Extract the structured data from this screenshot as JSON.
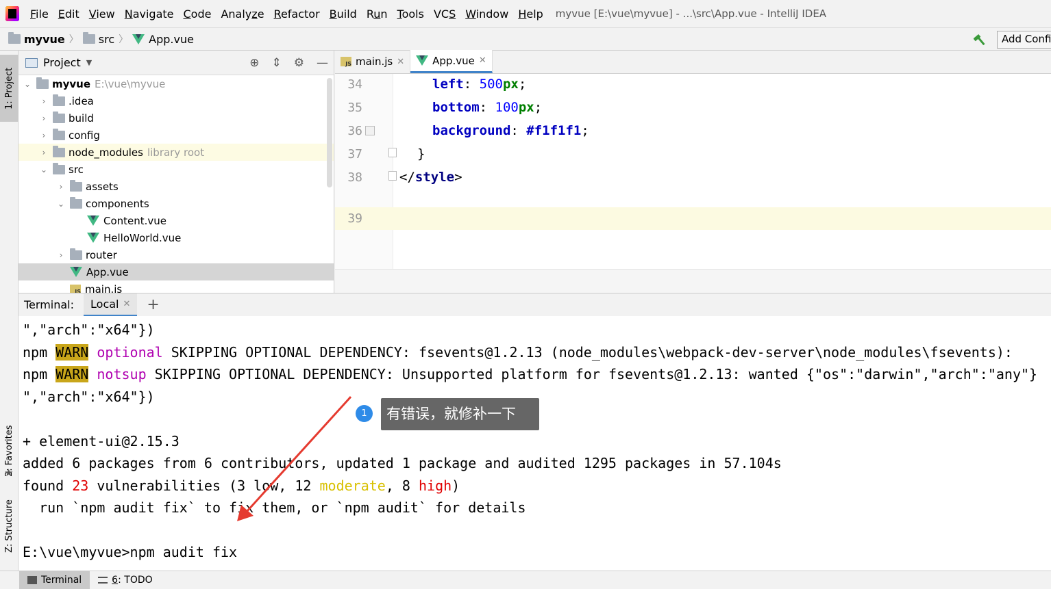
{
  "window_title": "myvue [E:\\vue\\myvue] - ...\\src\\App.vue - IntelliJ IDEA",
  "menu": [
    {
      "pre": "",
      "u": "F",
      "post": "ile"
    },
    {
      "pre": "",
      "u": "E",
      "post": "dit"
    },
    {
      "pre": "",
      "u": "V",
      "post": "iew"
    },
    {
      "pre": "",
      "u": "N",
      "post": "avigate"
    },
    {
      "pre": "",
      "u": "C",
      "post": "ode"
    },
    {
      "pre": "Analy",
      "u": "z",
      "post": "e"
    },
    {
      "pre": "",
      "u": "R",
      "post": "efactor"
    },
    {
      "pre": "",
      "u": "B",
      "post": "uild"
    },
    {
      "pre": "R",
      "u": "u",
      "post": "n"
    },
    {
      "pre": "",
      "u": "T",
      "post": "ools"
    },
    {
      "pre": "VC",
      "u": "S",
      "post": ""
    },
    {
      "pre": "",
      "u": "W",
      "post": "indow"
    },
    {
      "pre": "",
      "u": "H",
      "post": "elp"
    }
  ],
  "breadcrumb": {
    "project": "myvue",
    "folder": "src",
    "file": "App.vue"
  },
  "toolbar": {
    "add_config": "Add Configuration..."
  },
  "left_strip": {
    "project": "1: Project",
    "favorites": "2: Favorites",
    "structure": "Z: Structure"
  },
  "project_panel": {
    "title": "Project",
    "tree": [
      {
        "name": "myvue",
        "extra": "E:\\vue\\myvue",
        "type": "project",
        "arrow": "v"
      },
      {
        "name": ".idea",
        "type": "folder",
        "arrow": ">"
      },
      {
        "name": "build",
        "type": "folder",
        "arrow": ">"
      },
      {
        "name": "config",
        "type": "folder",
        "arrow": ">"
      },
      {
        "name": "node_modules",
        "extra": "library root",
        "type": "folder",
        "arrow": ">"
      },
      {
        "name": "src",
        "type": "folder",
        "arrow": "v"
      },
      {
        "name": "assets",
        "type": "folder",
        "arrow": ">"
      },
      {
        "name": "components",
        "type": "folder",
        "arrow": "v"
      },
      {
        "name": "Content.vue",
        "type": "vue"
      },
      {
        "name": "HelloWorld.vue",
        "type": "vue"
      },
      {
        "name": "router",
        "type": "folder",
        "arrow": ">"
      },
      {
        "name": "App.vue",
        "type": "vue"
      },
      {
        "name": "main.js",
        "type": "js"
      }
    ]
  },
  "editor": {
    "tabs": [
      {
        "label": "main.js"
      },
      {
        "label": "App.vue"
      }
    ],
    "lines": [
      {
        "n": "34",
        "prop": "left",
        "num": "500",
        "unit": "px"
      },
      {
        "n": "35",
        "prop": "bottom",
        "num": "100",
        "unit": "px"
      },
      {
        "n": "36",
        "prop": "background",
        "value": "#f1f1f1"
      },
      {
        "n": "37",
        "text": "}"
      },
      {
        "n": "38",
        "tag": "style"
      },
      {
        "n": "39"
      }
    ]
  },
  "terminal": {
    "label": "Terminal:",
    "tab": "Local",
    "lines": {
      "l1": "\",\"arch\":\"x64\"})",
      "l2_a": "npm ",
      "l2_warn": "WARN",
      "l2_b": " ",
      "l2_kind": "optional",
      "l2_c": " SKIPPING OPTIONAL DEPENDENCY: fsevents@1.2.13 (node_modules\\webpack-dev-server\\node_modules\\fsevents):",
      "l3_a": "npm ",
      "l3_warn": "WARN",
      "l3_b": " ",
      "l3_kind": "notsup",
      "l3_c": " SKIPPING OPTIONAL DEPENDENCY: Unsupported platform for fsevents@1.2.13: wanted {\"os\":\"darwin\",\"arch\":\"any\"}",
      "l4": "\",\"arch\":\"x64\"})",
      "l5": "+ element-ui@2.15.3",
      "l6": "added 6 packages from 6 contributors, updated 1 package and audited 1295 packages in 57.104s",
      "l7_a": "found ",
      "l7_n": "23",
      "l7_b": " vulnerabilities (3 low, 12 ",
      "l7_mod": "moderate",
      "l7_c": ", 8 ",
      "l7_high": "high",
      "l7_d": ")",
      "l8": "  run `npm audit fix` to fix them, or `npm audit` for details",
      "l9": "E:\\vue\\myvue>npm audit fix"
    }
  },
  "annotation": {
    "badge": "1",
    "text": "有错误，就修补一下"
  },
  "status_bar": {
    "terminal": "Terminal",
    "todo_num": "6",
    "todo": ": TODO"
  },
  "colors": {
    "accent": "#4083c9",
    "warn_bg": "#c9a61a",
    "vue_green": "#41b883",
    "annotation_arrow": "#e53a2f"
  }
}
